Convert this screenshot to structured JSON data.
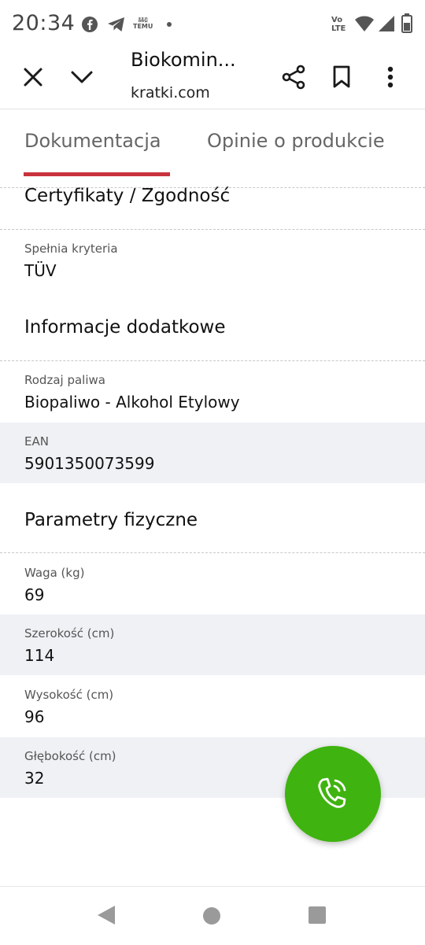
{
  "status_bar": {
    "time": "20:34",
    "notification_icons": [
      "facebook-icon",
      "telegram-icon",
      "temu-icon",
      "dot-icon"
    ],
    "temu_top": "ﾙﾙﾛ",
    "temu_bottom": "TEMU",
    "network_top": "Vo",
    "network_bottom": "LTE",
    "system_icons": [
      "volte-icon",
      "wifi-icon",
      "signal-icon",
      "battery-icon"
    ]
  },
  "app_bar": {
    "title": "Biokomin...",
    "domain": "kratki.com",
    "icons": [
      "close-icon",
      "chevron-down-icon",
      "share-icon",
      "bookmark-icon",
      "more-vert-icon"
    ]
  },
  "tabs": [
    {
      "label": "Dokumentacja",
      "active": true
    },
    {
      "label": "Opinie o produkcie",
      "active": false
    }
  ],
  "sections": {
    "certificates": {
      "title": "Certyfikaty / Zgodność",
      "rows": [
        {
          "label": "Spełnia kryteria",
          "value": "TÜV"
        }
      ]
    },
    "additional_info": {
      "title": "Informacje dodatkowe",
      "rows": [
        {
          "label": "Rodzaj paliwa",
          "value": "Biopaliwo - Alkohol Etylowy"
        },
        {
          "label": "EAN",
          "value": "5901350073599"
        }
      ]
    },
    "physical_params": {
      "title": "Parametry fizyczne",
      "rows": [
        {
          "label": "Waga (kg)",
          "value": "69"
        },
        {
          "label": "Szerokość (cm)",
          "value": "114"
        },
        {
          "label": "Wysokość (cm)",
          "value": "96"
        },
        {
          "label": "Głębokość (cm)",
          "value": "32"
        }
      ]
    }
  },
  "fab": {
    "icon": "phone-call-icon"
  },
  "colors": {
    "accent": "#c8323d",
    "fab": "#3fb30f",
    "row_shade": "#eff1f4"
  },
  "nav_bar": {
    "icons": [
      "back-icon",
      "home-icon",
      "recents-icon"
    ]
  }
}
